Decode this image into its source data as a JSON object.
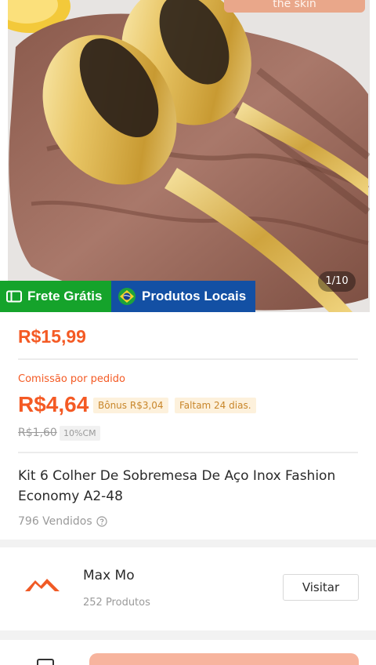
{
  "product_image": {
    "caption_chip": "the skin",
    "counter": "1/10",
    "badges": {
      "free_shipping": "Frete Grátis",
      "local_products": "Produtos Locais"
    }
  },
  "pricing": {
    "price": "R$15,99",
    "commission_label": "Comissão por pedido",
    "commission_value": "R$4,64",
    "bonus": "Bônus R$3,04",
    "days_left": "Faltam 24 dias.",
    "old_commission": "R$1,60",
    "commission_rate": "10%CM"
  },
  "product": {
    "title": "Kit 6 Colher De Sobremesa De Aço Inox Fashion Economy A2-48",
    "sold": "796 Vendidos"
  },
  "shop": {
    "name": "Max Mo",
    "products_count": "252 Produtos",
    "visit_label": "Visitar"
  },
  "colors": {
    "accent": "#f45a24",
    "green_badge": "#15a32b",
    "blue_badge": "#1350a4",
    "bonus_bg": "#fdf1dc",
    "bonus_text": "#c8862a"
  },
  "icons": [
    "truck-icon",
    "brazil-flag-icon",
    "question-circle-icon",
    "mountain-logo-icon",
    "chat-icon"
  ]
}
